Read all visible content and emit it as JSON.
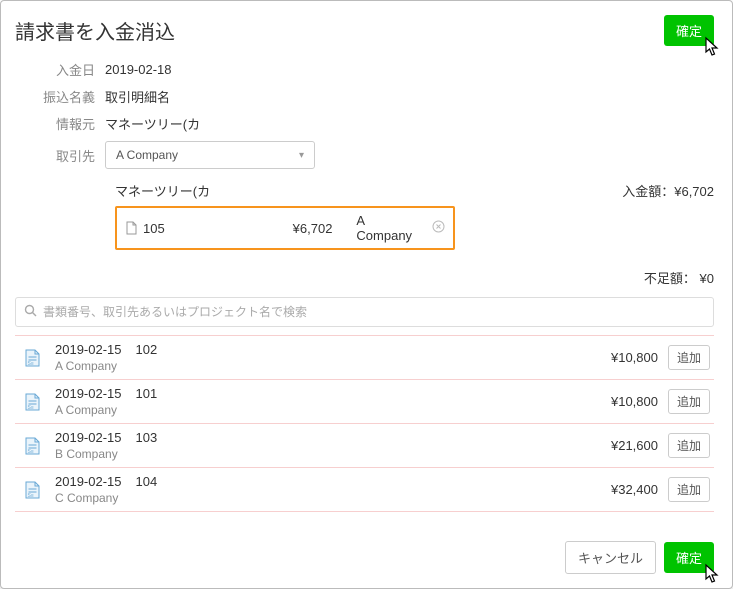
{
  "title": "請求書を入金消込",
  "confirm_label": "確定",
  "form": {
    "deposit_date_label": "入金日",
    "deposit_date": "2019-02-18",
    "transfer_name_label": "振込名義",
    "transfer_name": "取引明細名",
    "source_label": "情報元",
    "source": "マネーツリー(カ",
    "client_label": "取引先",
    "client_selected": "A Company"
  },
  "summary": {
    "source_name": "マネーツリー(カ",
    "deposit_amount_label": "入金額：",
    "deposit_amount": "¥6,702",
    "applied_doc_number": "105",
    "applied_amount": "¥6,702",
    "applied_company": "A Company",
    "shortfall_label": "不足額：",
    "shortfall_amount": "¥0"
  },
  "search_placeholder": "書類番号、取引先あるいはプロジェクト名で検索",
  "list": [
    {
      "date": "2019-02-15",
      "number": "102",
      "company": "A Company",
      "amount": "¥10,800"
    },
    {
      "date": "2019-02-15",
      "number": "101",
      "company": "A Company",
      "amount": "¥10,800"
    },
    {
      "date": "2019-02-15",
      "number": "103",
      "company": "B Company",
      "amount": "¥21,600"
    },
    {
      "date": "2019-02-15",
      "number": "104",
      "company": "C Company",
      "amount": "¥32,400"
    }
  ],
  "add_label": "追加",
  "cancel_label": "キャンセル"
}
